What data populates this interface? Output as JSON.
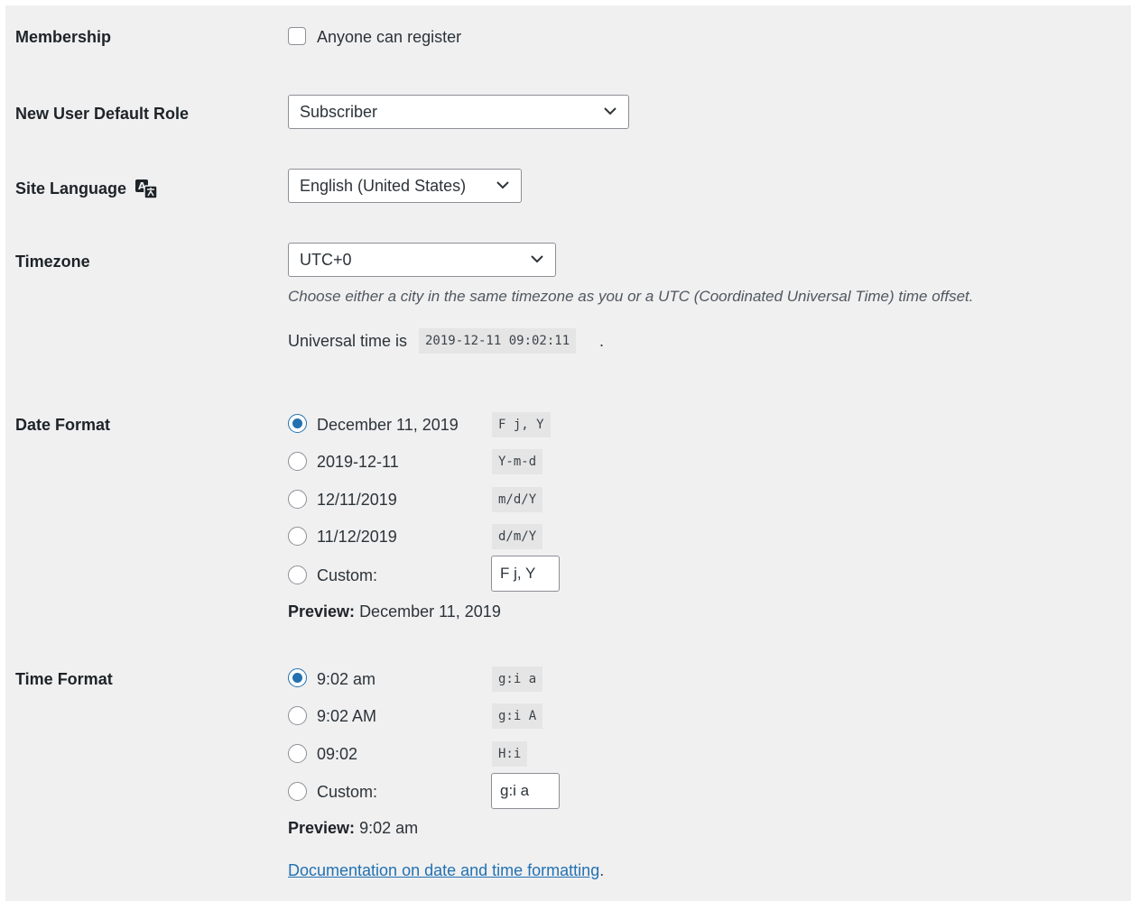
{
  "membership": {
    "label": "Membership",
    "checkbox_label": "Anyone can register",
    "checked": false
  },
  "default_role": {
    "label": "New User Default Role",
    "selected": "Subscriber"
  },
  "site_language": {
    "label": "Site Language",
    "icon": "translation-icon",
    "selected": "English (United States)"
  },
  "timezone": {
    "label": "Timezone",
    "selected": "UTC+0",
    "description": "Choose either a city in the same timezone as you or a UTC (Coordinated Universal Time) time offset.",
    "universal_prefix": "Universal time is",
    "universal_time": "2019-12-11 09:02:11",
    "universal_suffix": "."
  },
  "date_format": {
    "label": "Date Format",
    "options": [
      {
        "label": "December 11, 2019",
        "code": "F j, Y",
        "checked": true
      },
      {
        "label": "2019-12-11",
        "code": "Y-m-d",
        "checked": false
      },
      {
        "label": "12/11/2019",
        "code": "m/d/Y",
        "checked": false
      },
      {
        "label": "11/12/2019",
        "code": "d/m/Y",
        "checked": false
      }
    ],
    "custom_label": "Custom:",
    "custom_value": "F j, Y",
    "preview_label": "Preview:",
    "preview_value": "December 11, 2019"
  },
  "time_format": {
    "label": "Time Format",
    "options": [
      {
        "label": "9:02 am",
        "code": "g:i a",
        "checked": true
      },
      {
        "label": "9:02 AM",
        "code": "g:i A",
        "checked": false
      },
      {
        "label": "09:02",
        "code": "H:i",
        "checked": false
      }
    ],
    "custom_label": "Custom:",
    "custom_value": "g:i a",
    "preview_label": "Preview:",
    "preview_value": "9:02 am"
  },
  "documentation_link": "Documentation on date and time formatting",
  "documentation_suffix": ".",
  "colors": {
    "background": "#f0f0f1",
    "accent": "#2271b1",
    "text": "#3c434a"
  }
}
